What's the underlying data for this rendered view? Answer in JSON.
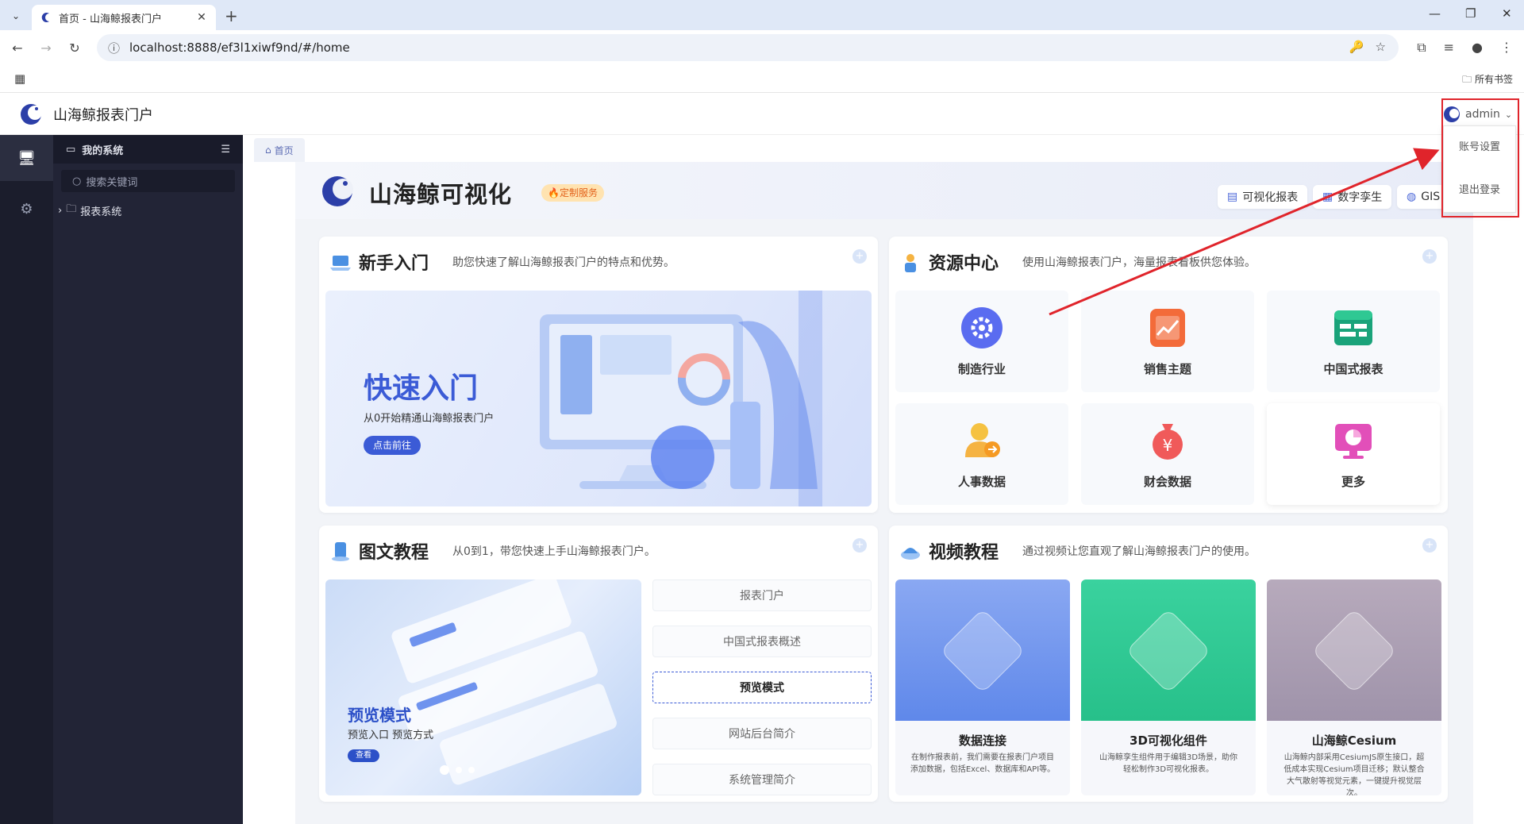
{
  "browser": {
    "tab_title": "首页 - 山海鲸报表门户",
    "url": "localhost:8888/ef3l1xiwf9nd/#/home",
    "bookmarks_all": "所有书签"
  },
  "app": {
    "title": "山海鲸报表门户",
    "user": "admin",
    "user_menu": [
      "账号设置",
      "退出登录"
    ]
  },
  "sidebar": {
    "header": "我的系统",
    "search_placeholder": "搜索关键词",
    "tree_item": "报表系统"
  },
  "tagbar": {
    "home": "首页"
  },
  "banner": {
    "title": "山海鲸可视化",
    "badge": "定制服务",
    "buttons": [
      "可视化报表",
      "数字孪生",
      "GIS"
    ]
  },
  "getting_started": {
    "title": "新手入门",
    "desc": "助您快速了解山海鲸报表门户的特点和优势。",
    "hero_title": "快速入门",
    "hero_sub": "从0开始精通山海鲸报表门户",
    "hero_btn": "点击前往"
  },
  "resources": {
    "title": "资源中心",
    "desc": "使用山海鲸报表门户，海量报表看板供您体验。",
    "items": [
      "制造行业",
      "销售主题",
      "中国式报表",
      "人事数据",
      "财会数据",
      "更多"
    ]
  },
  "tutorials": {
    "title": "图文教程",
    "desc": "从0到1，带您快速上手山海鲸报表门户。",
    "img_title": "预览模式",
    "img_sub": "预览入口 预览方式",
    "img_btn": "查看",
    "items": [
      "报表门户",
      "中国式报表概述",
      "预览模式",
      "网站后台简介",
      "系统管理简介"
    ]
  },
  "videos": {
    "title": "视频教程",
    "desc": "通过视频让您直观了解山海鲸报表门户的使用。",
    "items": [
      {
        "title": "数据连接",
        "desc": "在制作报表前，我们需要在报表门户项目添加数据，包括Excel、数据库和API等。",
        "color": "#6f93ee"
      },
      {
        "title": "3D可视化组件",
        "desc": "山海鲸孪生组件用于编辑3D场景，助你轻松制作3D可视化报表。",
        "color": "#2fc893"
      },
      {
        "title": "山海鲸Cesium",
        "desc": "山海鲸内部采用CesiumJS原生接口，超低成本实现Cesium项目迁移；默认整合大气散射等视觉元素，一键提升视觉层次。",
        "color": "#a99db3"
      }
    ]
  },
  "colors": {
    "accent": "#3b5bd6",
    "highlight": "#e0242b",
    "sidebar_dark": "#1b1d2c"
  }
}
